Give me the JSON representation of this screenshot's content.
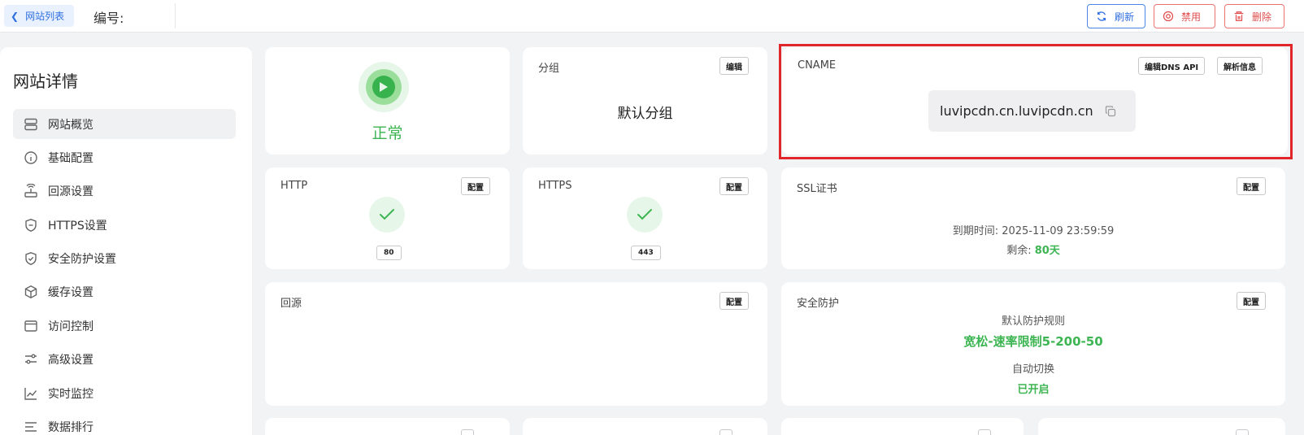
{
  "topbar": {
    "back_label": "网站列表",
    "number_label": "编号:",
    "refresh_label": "刷新",
    "disable_label": "禁用",
    "delete_label": "删除"
  },
  "sidebar": {
    "title": "网站详情",
    "items": [
      {
        "label": "网站概览",
        "icon": "server-icon"
      },
      {
        "label": "基础配置",
        "icon": "info-icon"
      },
      {
        "label": "回源设置",
        "icon": "router-icon"
      },
      {
        "label": "HTTPS设置",
        "icon": "shield-icon"
      },
      {
        "label": "安全防护设置",
        "icon": "shield-check-icon"
      },
      {
        "label": "缓存设置",
        "icon": "cube-icon"
      },
      {
        "label": "访问控制",
        "icon": "window-icon"
      },
      {
        "label": "高级设置",
        "icon": "sliders-icon"
      },
      {
        "label": "实时监控",
        "icon": "chart-line-icon"
      },
      {
        "label": "数据排行",
        "icon": "list-icon"
      }
    ]
  },
  "status_card": {
    "status_text": "正常"
  },
  "group_card": {
    "title": "分组",
    "edit_label": "编辑",
    "value": "默认分组"
  },
  "cname_card": {
    "title": "CNAME",
    "edit_dns_label": "编辑DNS API",
    "resolve_label": "解析信息",
    "value": "luvipcdn.cn.luvipcdn.cn"
  },
  "http_card": {
    "title": "HTTP",
    "config_label": "配置",
    "port": "80"
  },
  "https_card": {
    "title": "HTTPS",
    "config_label": "配置",
    "port": "443"
  },
  "ssl_card": {
    "title": "SSL证书",
    "config_label": "配置",
    "expire_label": "到期时间:",
    "expire_value": "2025-11-09 23:59:59",
    "remaining_label": "剩余:",
    "remaining_value": "80天"
  },
  "origin_card": {
    "title": "回源",
    "config_label": "配置"
  },
  "security_card": {
    "title": "安全防护",
    "config_label": "配置",
    "rule_label": "默认防护规则",
    "rule_value": "宽松-速率限制5-200-50",
    "auto_label": "自动切换",
    "auto_value": "已开启"
  },
  "colors": {
    "accent": "#2f6fe0",
    "danger": "#e04b4b",
    "success": "#3db552",
    "highlight": "#e0262a"
  }
}
